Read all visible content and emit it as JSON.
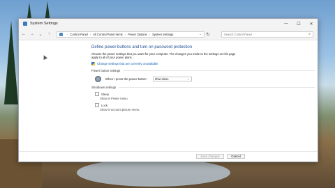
{
  "window": {
    "title": "System Settings",
    "controls": {
      "minimize": "—",
      "maximize": "☐",
      "close": "✕"
    }
  },
  "nav": {
    "back": "←",
    "forward": "→",
    "up": "↑",
    "breadcrumbs": [
      "Control Panel",
      "All Control Panel Items",
      "Power Options",
      "System Settings"
    ],
    "refresh": "↻",
    "search_placeholder": "Search Control Panel"
  },
  "content": {
    "heading": "Define power buttons and turn on password protection",
    "description": "Choose the power settings that you want for your computer. The changes you make to the settings on this page apply to all of your power plans.",
    "change_link": "Change settings that are currently unavailable",
    "power_section": "Power button settings",
    "power_label": "When I press the power button:",
    "power_value": "Shut down",
    "shutdown_section": "Shutdown settings",
    "sleep_label": "Sleep",
    "sleep_desc": "Show in Power menu.",
    "lock_label": "Lock",
    "lock_desc": "Show in account picture menu."
  },
  "footer": {
    "save": "Save changes",
    "cancel": "Cancel"
  },
  "icons": [
    "app-icon",
    "control-panel-icon",
    "search-icon",
    "shield-icon",
    "power-icon",
    "dropdown-icon"
  ]
}
